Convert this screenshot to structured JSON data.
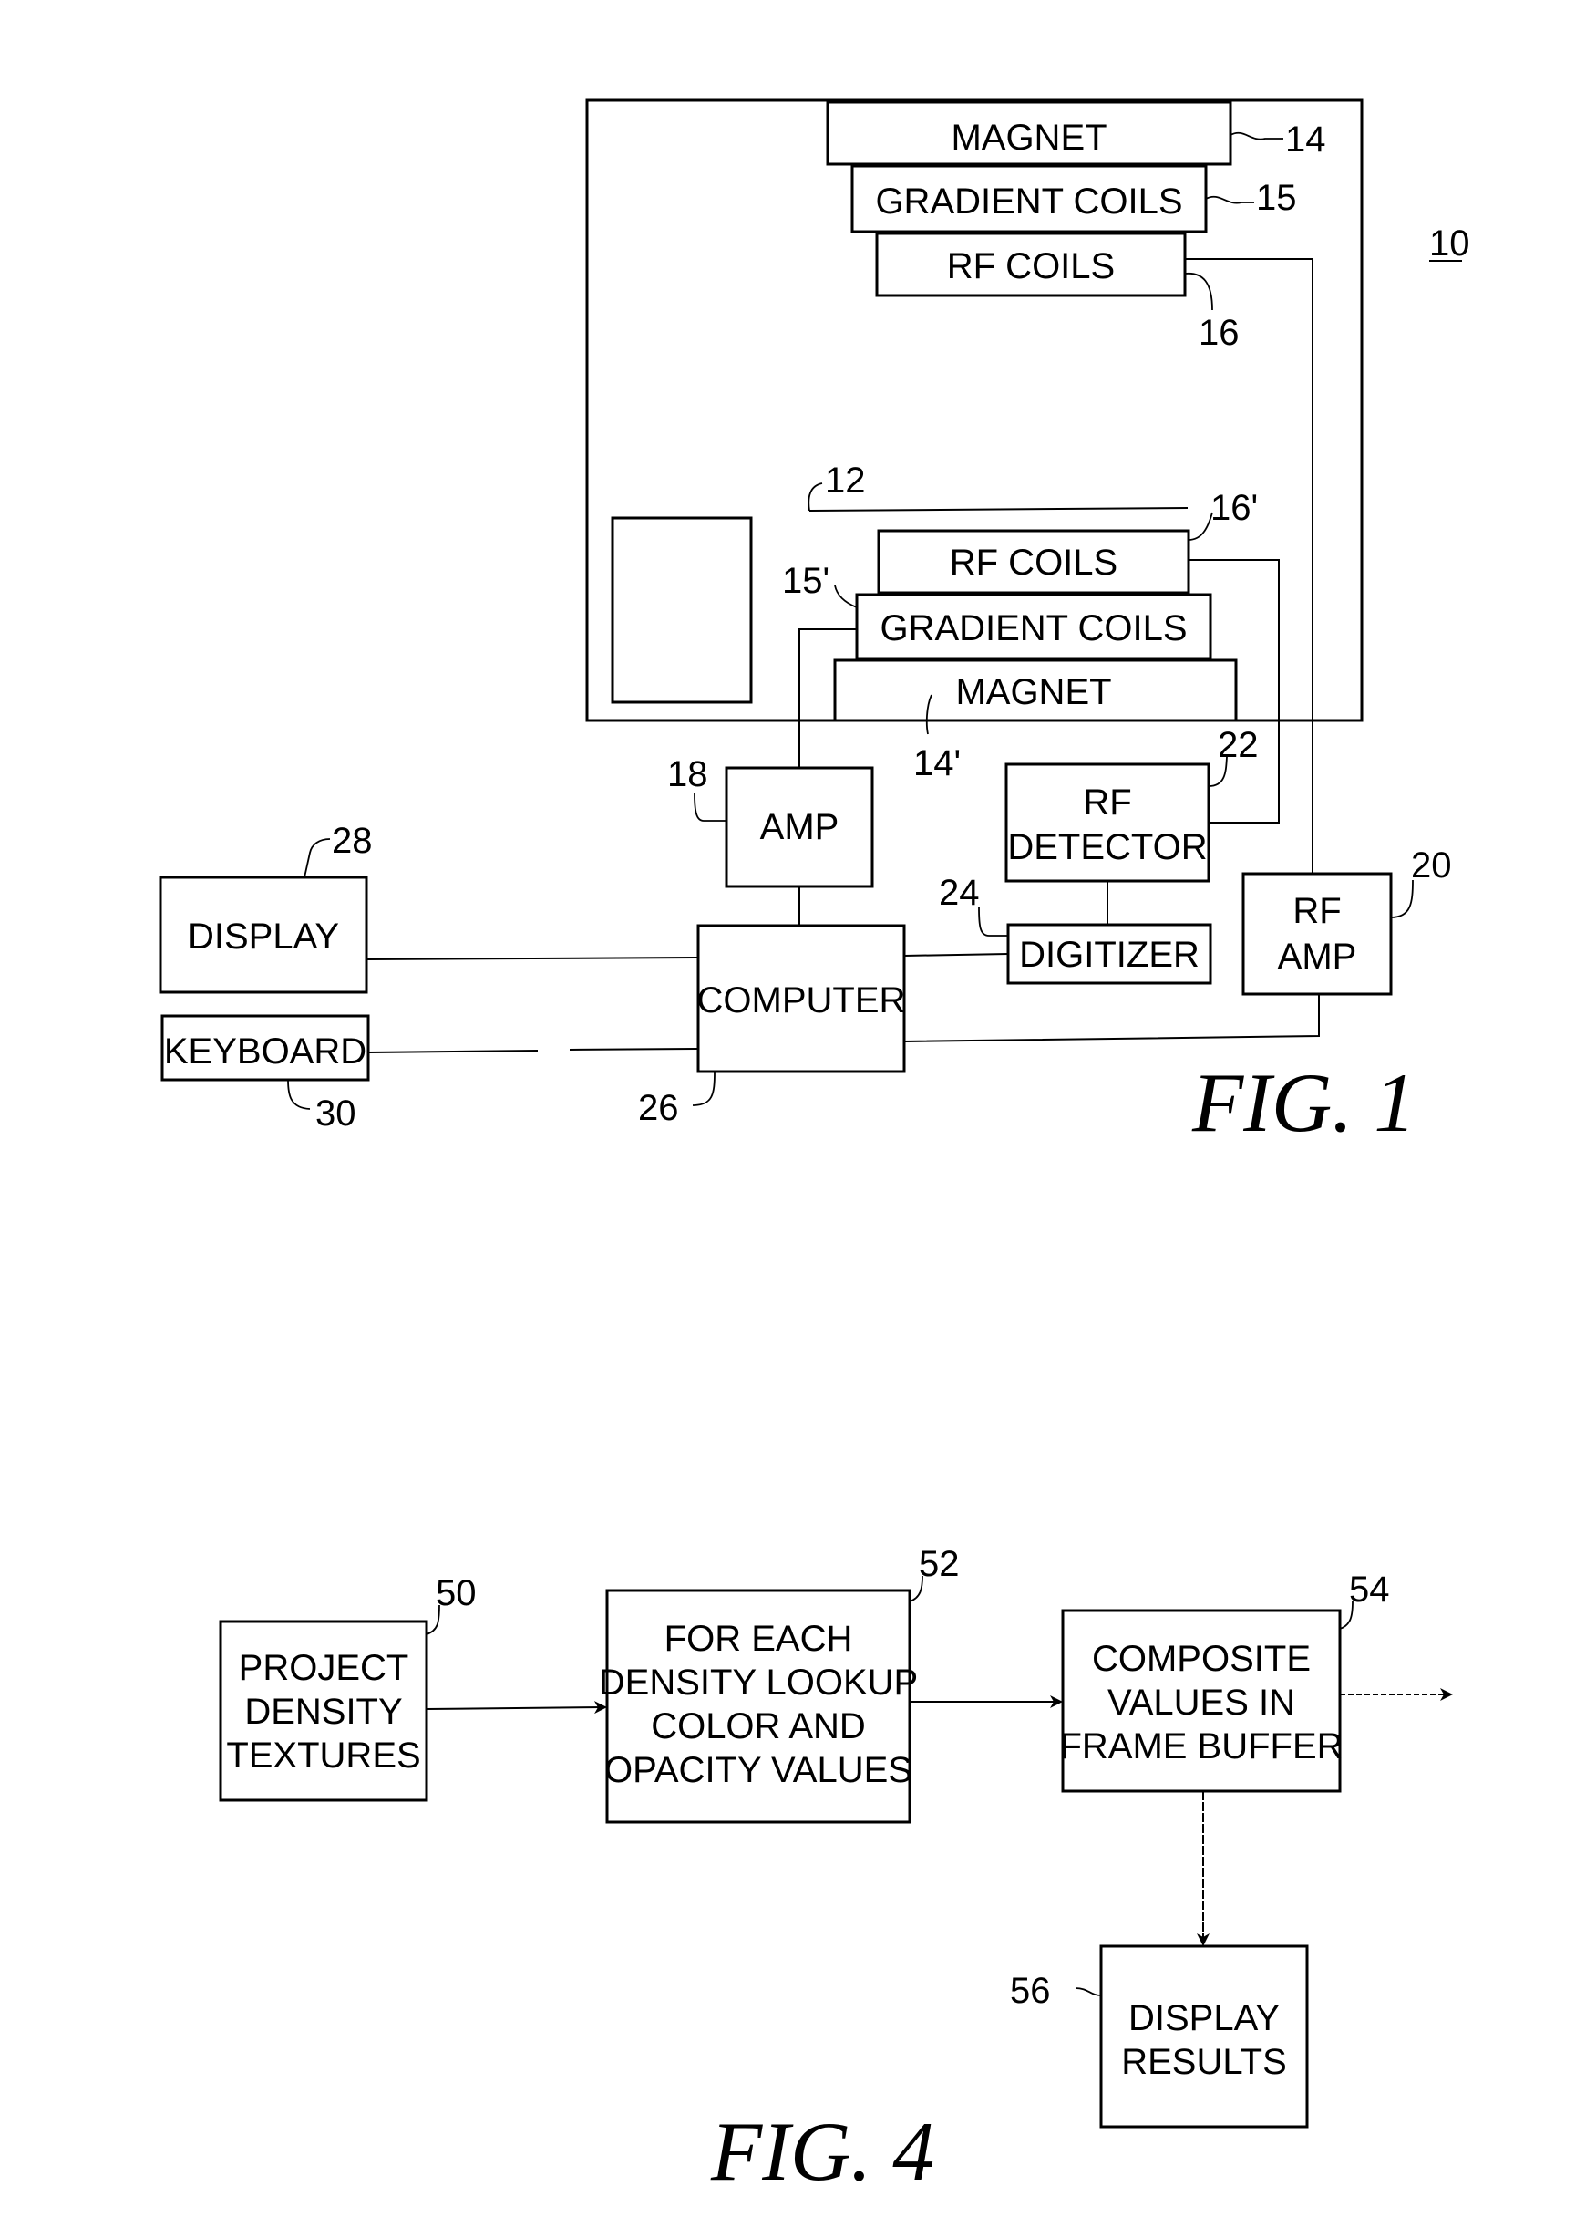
{
  "figure1": {
    "caption": "FIG. 1",
    "system_ref": "10",
    "upper_stack": [
      {
        "label": "MAGNET",
        "ref": "14"
      },
      {
        "label": "GRADIENT COILS",
        "ref": "15"
      },
      {
        "label": "RF COILS",
        "ref": "16"
      }
    ],
    "lower_stack": [
      {
        "label": "RF COILS",
        "ref": "16'"
      },
      {
        "label": "GRADIENT COILS",
        "ref": "15'"
      },
      {
        "label": "MAGNET",
        "ref": "14'"
      }
    ],
    "subject_ref": "12",
    "blocks": {
      "amp": {
        "label": "AMP",
        "ref": "18"
      },
      "rf_detector": {
        "label_line1": "RF",
        "label_line2": "DETECTOR",
        "ref": "22"
      },
      "rf_amp": {
        "label_line1": "RF",
        "label_line2": "AMP",
        "ref": "20"
      },
      "digitizer": {
        "label": "DIGITIZER",
        "ref": "24"
      },
      "computer": {
        "label": "COMPUTER",
        "ref": "26"
      },
      "display": {
        "label": "DISPLAY",
        "ref": "28"
      },
      "keyboard": {
        "label": "KEYBOARD",
        "ref": "30"
      }
    }
  },
  "figure4": {
    "caption": "FIG. 4",
    "steps": [
      {
        "ref": "50",
        "lines": [
          "PROJECT",
          "DENSITY",
          "TEXTURES"
        ]
      },
      {
        "ref": "52",
        "lines": [
          "FOR EACH",
          "DENSITY LOOKUP",
          "COLOR AND",
          "OPACITY VALUES"
        ]
      },
      {
        "ref": "54",
        "lines": [
          "COMPOSITE",
          "VALUES IN",
          "FRAME BUFFER"
        ]
      },
      {
        "ref": "56",
        "lines": [
          "DISPLAY",
          "RESULTS"
        ]
      }
    ]
  }
}
